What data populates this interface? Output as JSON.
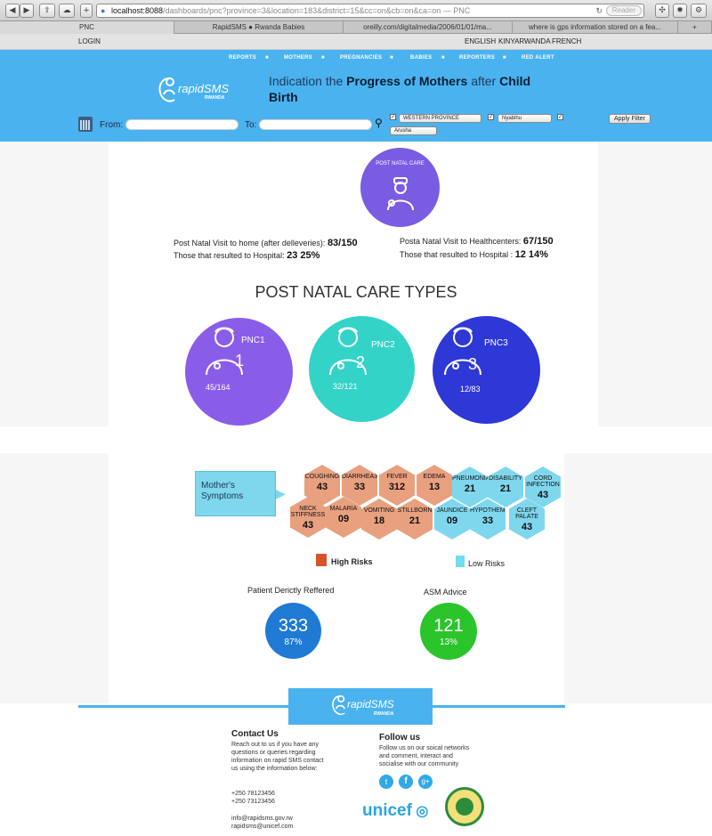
{
  "browser": {
    "url_main": "localhost:8088",
    "url_rest": "/dashboards/pnc?province=3&location=183&district=15&cc=on&cb=on&ca=on — PNC",
    "reader_label": "Reader",
    "tabs": [
      "PNC",
      "RapidSMS ● Rwanda Babies",
      "oreilly.com/digitalmedia/2006/01/01/ma...",
      "where is gps information stored on a fea..."
    ]
  },
  "topbar": {
    "login": "LOGIN",
    "langs": [
      "ENGLISH",
      "KINYARWANDA",
      "FRENCH"
    ]
  },
  "nav": [
    "REPORTS",
    "MOTHERS",
    "PREGNANCIES",
    "BABIES",
    "REPORTERS",
    "RED ALERT"
  ],
  "header": {
    "title_p1": "Indication the ",
    "title_b1": "Progress of Mothers",
    "title_p2": " after ",
    "title_b2": "Child",
    "title_b3": "Birth",
    "logo_text": "rapidSMS",
    "logo_sub": "RWANDA"
  },
  "filter": {
    "from_label": "From:",
    "to_label": "To:",
    "province": "WESTERN PROVINCE",
    "district": "Nyabihu",
    "location": "Arusha",
    "apply": "Apply Filter"
  },
  "pnc": {
    "badge": "POST NATAL CARE",
    "home_label": "Post Natal Visit to home (after delleveries):",
    "home_val": "83/150",
    "home_hosp_label": "Those that resulted to Hospital:",
    "home_hosp_val": "23 25%",
    "hc_label": "Posta Natal Visit to Healthcenters:",
    "hc_val": "67/150",
    "hc_hosp_label": "Those that resulted to Hospital :",
    "hc_hosp_val": "12 14%"
  },
  "types": {
    "heading": "POST NATAL CARE TYPES",
    "items": [
      {
        "name": "PNC1",
        "value": "45/164",
        "digit": "1",
        "color": "#8a5de8"
      },
      {
        "name": "PNC2",
        "value": "32/121",
        "digit": "2",
        "color": "#34d3c8"
      },
      {
        "name": "PNC3",
        "value": "12/83",
        "digit": "3",
        "color": "#2e38d6"
      }
    ]
  },
  "symptoms": {
    "label": "Mother's Symptoms",
    "high_legend": "High Risks",
    "low_legend": "Low Risks",
    "high_color": "#d5542a",
    "low_color": "#6fdcf0",
    "hexes": [
      {
        "name": "COUGHING",
        "n": "43",
        "risk": "hi"
      },
      {
        "name": "DIARRHEA33",
        "n": "33",
        "risk": "hi"
      },
      {
        "name": "FEVER",
        "n": "312",
        "risk": "hi"
      },
      {
        "name": "EDEMA",
        "n": "13",
        "risk": "hi"
      },
      {
        "name": "PNEUMONIA",
        "n": "21",
        "risk": "lo"
      },
      {
        "name": "DISABILITY",
        "n": "21",
        "risk": "lo"
      },
      {
        "name": "CORD INFECTION",
        "n": "43",
        "risk": "lo"
      },
      {
        "name": "NECK STIFFNESS",
        "n": "43",
        "risk": "hi"
      },
      {
        "name": "MALARIA",
        "n": "09",
        "risk": "hi"
      },
      {
        "name": "VOMITING",
        "n": "18",
        "risk": "hi"
      },
      {
        "name": "STILLBORN",
        "n": "21",
        "risk": "hi"
      },
      {
        "name": "JAUNDICE",
        "n": "09",
        "risk": "lo"
      },
      {
        "name": "HYPOTHEMIA",
        "n": "33",
        "risk": "lo"
      },
      {
        "name": "CLEFT PALATE",
        "n": "43",
        "risk": "lo"
      }
    ]
  },
  "referred": {
    "label": "Patient Derictly Reffered",
    "value": "333",
    "pct": "87%",
    "color": "#1f7ad4"
  },
  "advice": {
    "label": "ASM Advice",
    "value": "121",
    "pct": "13%",
    "color": "#2bc42b"
  },
  "footer": {
    "contact_title": "Contact Us",
    "contact_body": "Reach out to us if you have any questions or queries regarding information on rapid SMS contact us using the information below:",
    "phone1": "+250 78123456",
    "phone2": "+250 73123456",
    "email1": "info@rapidsms.gov.rw",
    "email2": "rapidsms@unicef.com",
    "follow_title": "Follow us",
    "follow_body": "Follow us on our soical networks and comment, interact and socialise with our community",
    "unicef": "unicef"
  }
}
